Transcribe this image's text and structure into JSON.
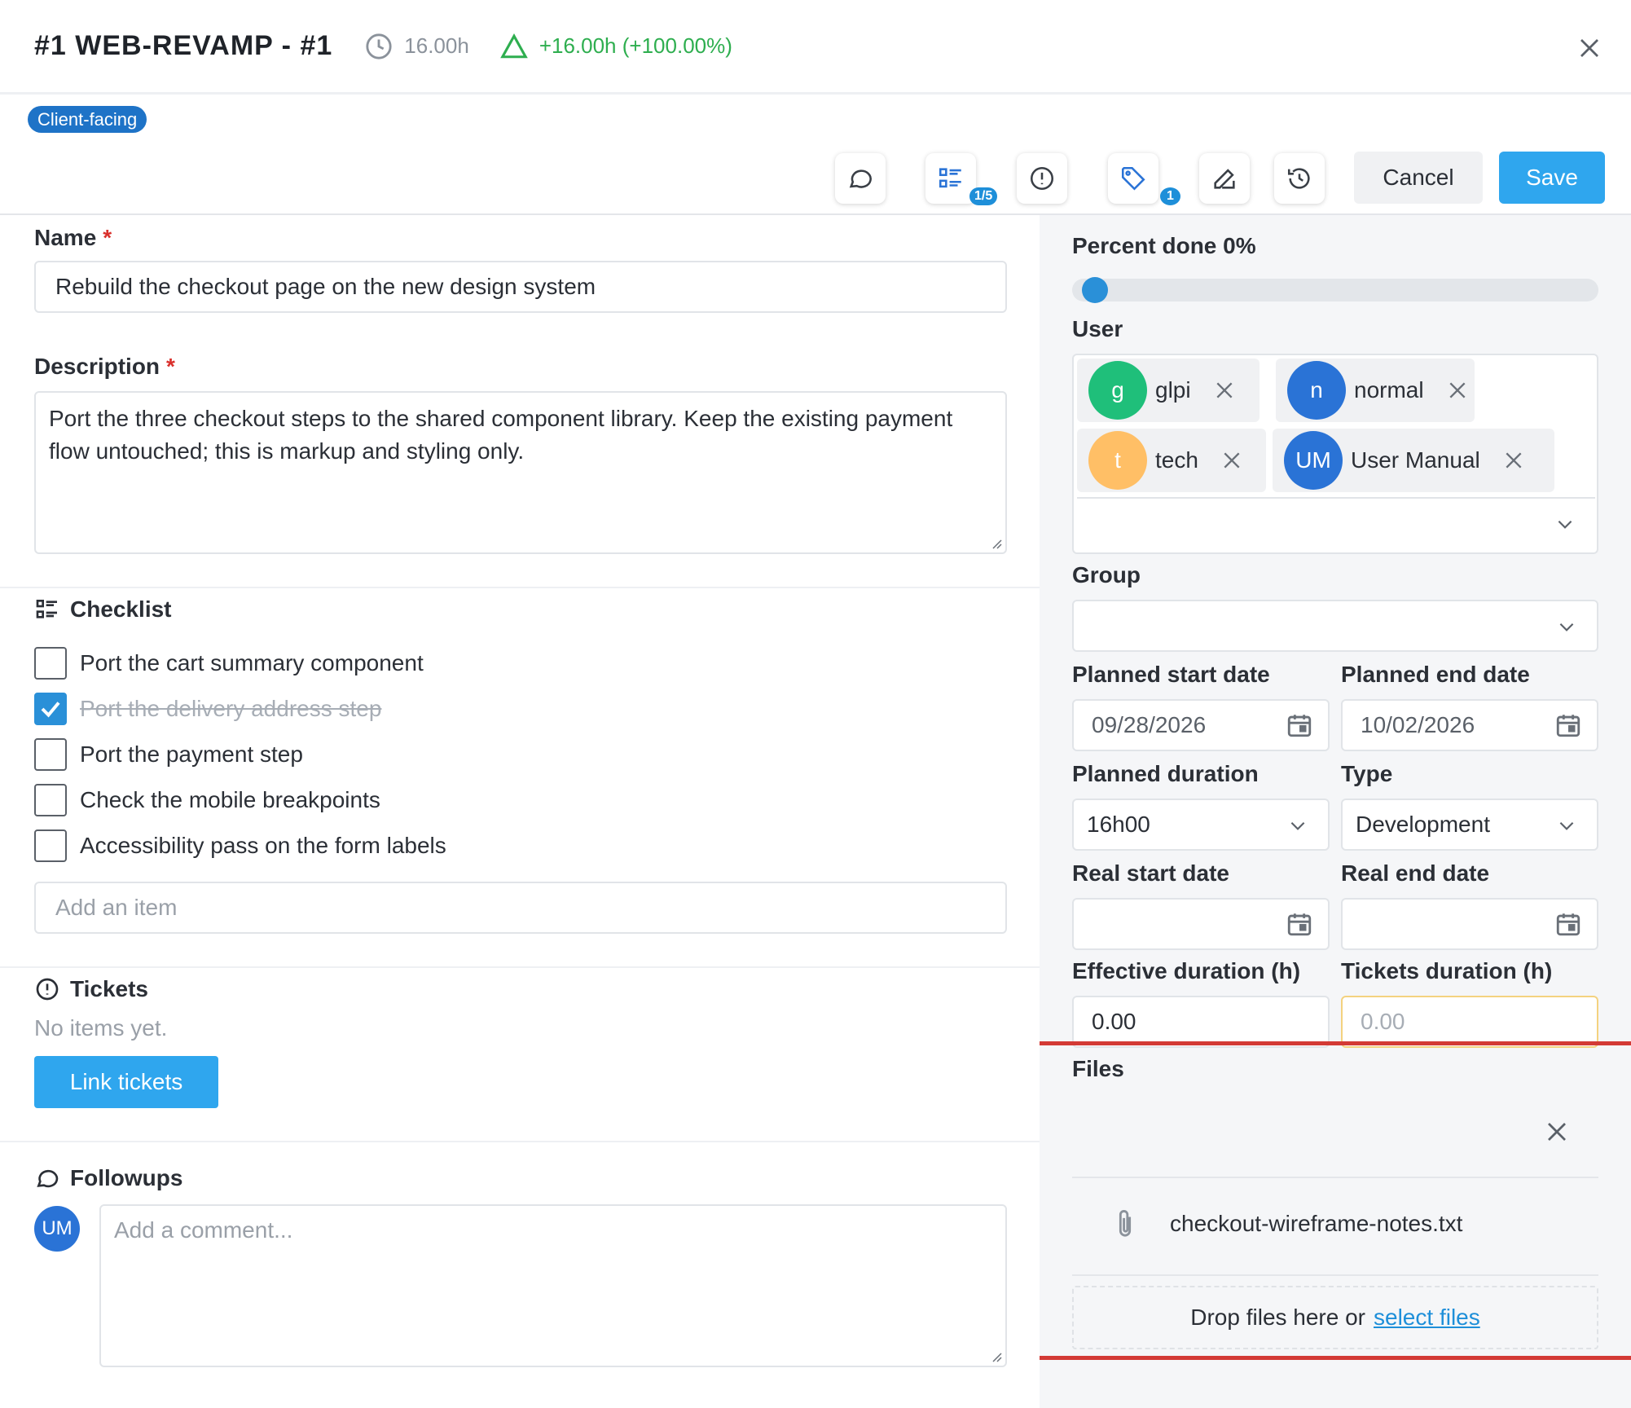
{
  "header": {
    "title": "#1 WEB-REVAMP - #1",
    "planned_hours": "16.00h",
    "delta": "+16.00h (+100.00%)",
    "colors": {
      "delta": "#2eae4f",
      "accent": "#2fa6ee"
    }
  },
  "tag": "Client-facing",
  "toolbar": {
    "checklist_badge": "1/5",
    "tags_badge": "1",
    "cancel_label": "Cancel",
    "save_label": "Save"
  },
  "form": {
    "name_label": "Name",
    "name_required": "*",
    "name_value": "Rebuild the checkout page on the new design system",
    "description_label": "Description",
    "description_required": "*",
    "description_value": "Port the three checkout steps to the shared component library. Keep the existing payment flow untouched; this is markup and styling only."
  },
  "checklist": {
    "title": "Checklist",
    "items": [
      {
        "label": "Port the cart summary component",
        "checked": false
      },
      {
        "label": "Port the delivery address step",
        "checked": true
      },
      {
        "label": "Port the payment step",
        "checked": false
      },
      {
        "label": "Check the mobile breakpoints",
        "checked": false
      },
      {
        "label": "Accessibility pass on the form labels",
        "checked": false
      }
    ],
    "add_placeholder": "Add an item"
  },
  "tickets": {
    "title": "Tickets",
    "empty_text": "No items yet.",
    "link_label": "Link tickets"
  },
  "followups": {
    "title": "Followups",
    "avatar_initials": "UM",
    "comment_placeholder": "Add a comment..."
  },
  "sidebar": {
    "percent_label": "Percent done 0%",
    "percent_value": 0,
    "user_label": "User",
    "users": [
      {
        "initial": "g",
        "name": "glpi",
        "color": "#1fbf7a"
      },
      {
        "initial": "n",
        "name": "normal",
        "color": "#2a73d6"
      },
      {
        "initial": "t",
        "name": "tech",
        "color": "#ffbf66"
      },
      {
        "initial": "UM",
        "name": "User Manual",
        "color": "#2a73d6"
      }
    ],
    "group_label": "Group",
    "planned_start_label": "Planned start date",
    "planned_start_value": "09/28/2026",
    "planned_end_label": "Planned end date",
    "planned_end_value": "10/02/2026",
    "planned_duration_label": "Planned duration",
    "planned_duration_value": "16h00",
    "type_label": "Type",
    "type_value": "Development",
    "real_start_label": "Real start date",
    "real_end_label": "Real end date",
    "effective_duration_label": "Effective duration (h)",
    "effective_duration_value": "0.00",
    "tickets_duration_label": "Tickets duration (h)",
    "tickets_duration_value": "0.00",
    "files_label": "Files",
    "file_name": "checkout-wireframe-notes.txt",
    "drop_text": "Drop files here or",
    "select_files": "select files"
  }
}
